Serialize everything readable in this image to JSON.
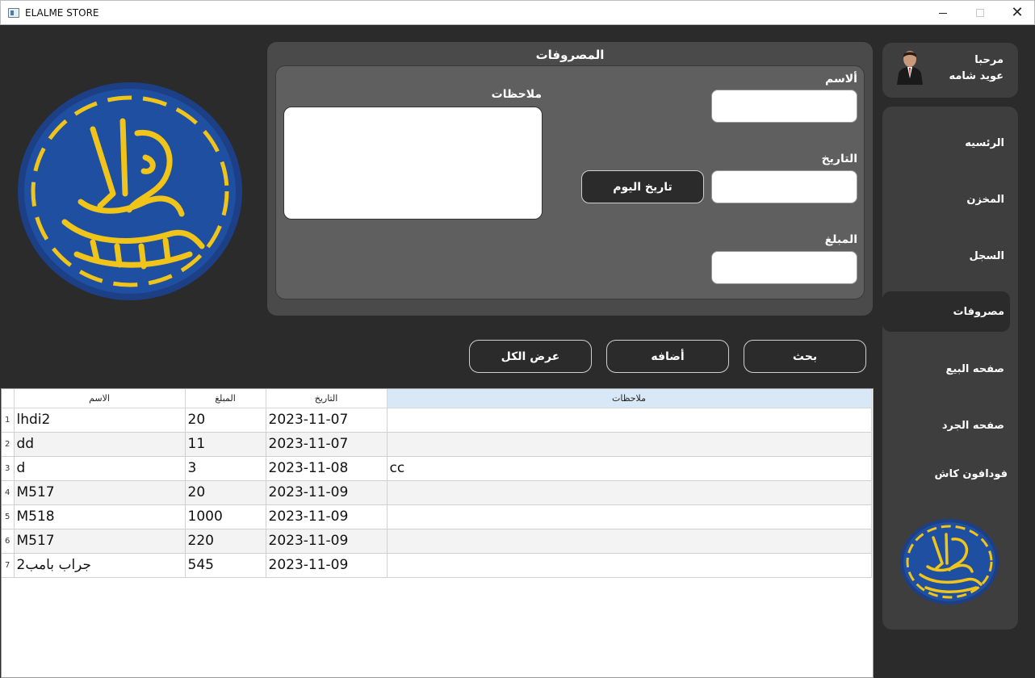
{
  "window": {
    "title": "ELALME STORE"
  },
  "user": {
    "greeting": "مرحبا",
    "name": "عويد شامه"
  },
  "nav": {
    "items": [
      {
        "label": "الرئسيه"
      },
      {
        "label": "المخزن"
      },
      {
        "label": "السجل"
      },
      {
        "label": "مصروفات",
        "active": true
      },
      {
        "label": "صفحه البيع"
      },
      {
        "label": "صفحه الجرد"
      },
      {
        "label": "فودافون كاش"
      }
    ]
  },
  "form": {
    "title": "المصروفات",
    "name_label": "ألاسم",
    "name_value": "",
    "date_label": "التاريخ",
    "date_value": "",
    "amount_label": "المبلغ",
    "amount_value": "",
    "notes_label": "ملاحظات",
    "notes_value": "",
    "today_button": "تاريخ اليوم"
  },
  "actions": {
    "search": "بحث",
    "add": "أضافه",
    "show_all": "عرض الكل"
  },
  "table": {
    "columns": [
      "الاسم",
      "المبلغ",
      "التاريخ",
      "ملاحظات"
    ],
    "selected_column": "ملاحظات",
    "rows": [
      {
        "num": "1",
        "name": "lhdi2",
        "amount": "20",
        "date": "2023-11-07",
        "notes": ""
      },
      {
        "num": "2",
        "name": "dd",
        "amount": "11",
        "date": "2023-11-07",
        "notes": ""
      },
      {
        "num": "3",
        "name": "d",
        "amount": "3",
        "date": "2023-11-08",
        "notes": "cc"
      },
      {
        "num": "4",
        "name": "M517",
        "amount": "20",
        "date": "2023-11-09",
        "notes": ""
      },
      {
        "num": "5",
        "name": "M518",
        "amount": "1000",
        "date": "2023-11-09",
        "notes": ""
      },
      {
        "num": "6",
        "name": "M517",
        "amount": "220",
        "date": "2023-11-09",
        "notes": ""
      },
      {
        "num": "7",
        "name": "جراب بامب2",
        "amount": "545",
        "date": "2023-11-09",
        "notes": ""
      }
    ]
  },
  "colors": {
    "background": "#2b2b2b",
    "panel": "#4a4a4a",
    "panel_inner": "#5f5f5f",
    "sidebar": "#3e3e3e",
    "logo_blue": "#1f4fa0",
    "logo_gold": "#f0c419",
    "header_selected": "#d9e8f7"
  },
  "icons": {
    "app": "window-app-icon",
    "avatar": "user-avatar-icon",
    "logo": "store-logo"
  }
}
